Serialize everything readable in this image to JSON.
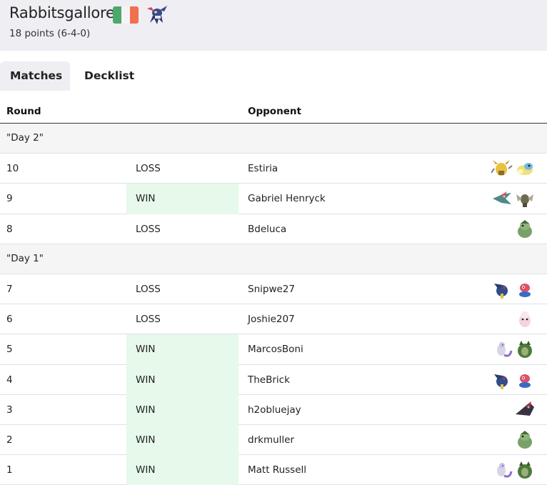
{
  "player": {
    "name": "Rabbitsgallore",
    "record": "18 points (6-4-0)",
    "flag": [
      "#4ea86b",
      "#f4f4f4",
      "#f26f4f"
    ],
    "sprite": "greninja-sprite"
  },
  "tabs": {
    "matches": "Matches",
    "decklist": "Decklist"
  },
  "table": {
    "headers": {
      "round": "Round",
      "opponent": "Opponent"
    },
    "rows": [
      {
        "type": "day",
        "label": "\"Day 2\""
      },
      {
        "type": "match",
        "round": "10",
        "result": "LOSS",
        "opponent": "Estiria",
        "sprites": [
          "alakazam",
          "dudunsparce"
        ]
      },
      {
        "type": "match",
        "round": "9",
        "result": "WIN",
        "opponent": "Gabriel Henryck",
        "sprites": [
          "dragapult",
          "kleavor"
        ]
      },
      {
        "type": "match",
        "round": "8",
        "result": "LOSS",
        "opponent": "Bdeluca",
        "sprites": [
          "slowking"
        ]
      },
      {
        "type": "day",
        "label": "\"Day 1\""
      },
      {
        "type": "match",
        "round": "7",
        "result": "LOSS",
        "opponent": "Snipwe27",
        "sprites": [
          "honchkrow",
          "porygon-z"
        ]
      },
      {
        "type": "match",
        "round": "6",
        "result": "LOSS",
        "opponent": "Joshie207",
        "sprites": [
          "slurpuff"
        ]
      },
      {
        "type": "match",
        "round": "5",
        "result": "WIN",
        "opponent": "MarcosBoni",
        "sprites": [
          "mewtwo",
          "tyranitar"
        ]
      },
      {
        "type": "match",
        "round": "4",
        "result": "WIN",
        "opponent": "TheBrick",
        "sprites": [
          "honchkrow",
          "porygon-z"
        ]
      },
      {
        "type": "match",
        "round": "3",
        "result": "WIN",
        "opponent": "h2obluejay",
        "sprites": [
          "zoroark"
        ]
      },
      {
        "type": "match",
        "round": "2",
        "result": "WIN",
        "opponent": "drkmuller",
        "sprites": [
          "slowking"
        ]
      },
      {
        "type": "match",
        "round": "1",
        "result": "WIN",
        "opponent": "Matt Russell",
        "sprites": [
          "mewtwo",
          "tyranitar"
        ]
      }
    ]
  }
}
